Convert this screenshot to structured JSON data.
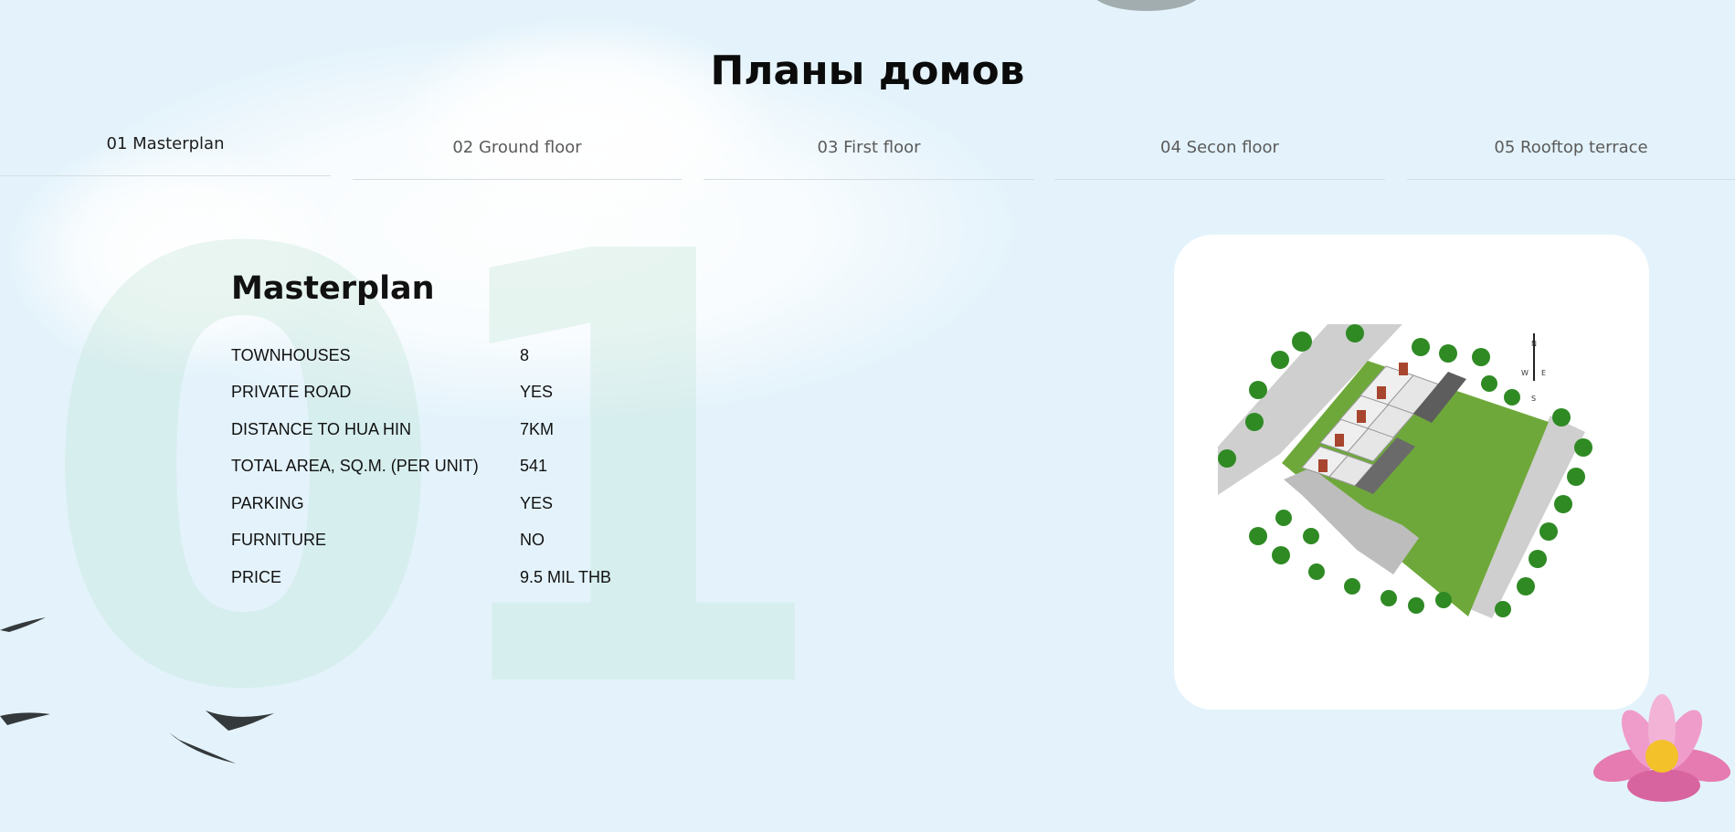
{
  "page": {
    "title": "Планы домов"
  },
  "tabs": [
    {
      "label": "01 Masterplan",
      "active": true
    },
    {
      "label": "02 Ground floor",
      "active": false
    },
    {
      "label": "03 First floor",
      "active": false
    },
    {
      "label": "04 Secon floor",
      "active": false
    },
    {
      "label": "05 Rooftop terrace",
      "active": false
    }
  ],
  "panel": {
    "big_number": "01",
    "title": "Masterplan",
    "specs": [
      {
        "key": "TOWNHOUSES",
        "value": "8"
      },
      {
        "key": "PRIVATE ROAD",
        "value": "YES"
      },
      {
        "key": "DISTANCE TO HUA HIN",
        "value": "7KM"
      },
      {
        "key": "TOTAL AREA, SQ.M. (PER UNIT)",
        "value": "541"
      },
      {
        "key": "PARKING",
        "value": "YES"
      },
      {
        "key": "FURNITURE",
        "value": "NO"
      },
      {
        "key": "PRICE",
        "value": "9.5 MIL THB"
      }
    ]
  },
  "compass": {
    "n": "N",
    "s": "S",
    "e": "E",
    "w": "W"
  },
  "icons": {
    "birds": "bird-icon",
    "flower": "lotus-flower-icon"
  },
  "colors": {
    "background": "#e4f3fb",
    "lawn": "#6ea83a",
    "tree": "#2f8a24",
    "road": "#cfcfcf"
  }
}
